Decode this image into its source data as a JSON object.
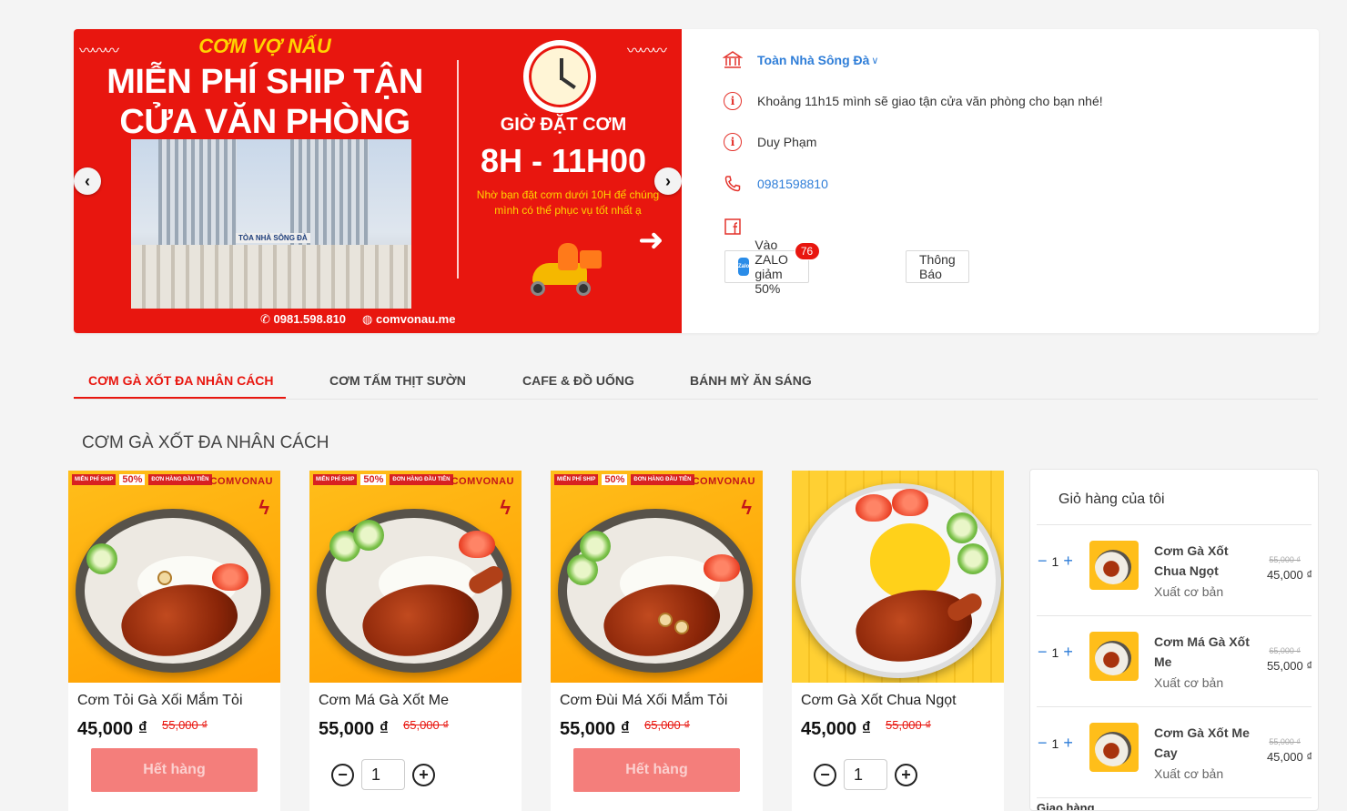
{
  "header": {
    "banner": {
      "brand": "CƠM VỢ NẤU",
      "headline_1": "MIỄN PHÍ SHIP TẬN",
      "headline_2": "CỬA VĂN PHÒNG",
      "building_sign": "TÒA NHÀ SÔNG ĐÀ",
      "order_label": "GIỜ ĐẶT CƠM",
      "order_time": "8H - 11H00",
      "note": "Nhờ bạn đặt cơm dưới 10H để chúng mình có thể phục vụ tốt nhất ạ",
      "phone": "0981.598.810",
      "website": "comvonau.me"
    },
    "info": {
      "location": "Toàn Nhà Sông Đà",
      "delivery_note": "Khoảng 11h15 mình sẽ giao tận cửa văn phòng cho bạn nhé!",
      "owner": "Duy Phạm",
      "phone": "0981598810"
    },
    "zalo_button": "Vào ZALO giảm 50%",
    "zalo_logo": "Zalo",
    "zalo_badge": "76",
    "notice_button": "Thông Báo"
  },
  "tabs": [
    {
      "label": "CƠM GÀ XỐT ĐA NHÂN CÁCH",
      "active": true
    },
    {
      "label": "CƠM TẤM THỊT SƯỜN",
      "active": false
    },
    {
      "label": "CAFE & ĐỒ UỐNG",
      "active": false
    },
    {
      "label": "BÁNH MỲ ĂN SÁNG",
      "active": false
    }
  ],
  "section_title": "CƠM GÀ XỐT ĐA NHÂN CÁCH",
  "product_tag": {
    "free_ship": "MIỄN PHÍ SHIP",
    "discount_pct": "50%",
    "first_order": "ĐƠN HÀNG ĐẦU TIÊN",
    "brand": "COMVONAU"
  },
  "products": [
    {
      "name": "Cơm Tỏi Gà Xối Mắm Tỏi",
      "price": "45,000 ₫",
      "old_price": "55,000 ₫",
      "action": "Hết hàng"
    },
    {
      "name": "Cơm Má Gà Xốt Me",
      "price": "55,000 ₫",
      "old_price": "65,000 ₫",
      "qty": "1"
    },
    {
      "name": "Cơm Đùi Má Xối Mắm Tỏi",
      "price": "55,000 ₫",
      "old_price": "65,000 ₫",
      "action": "Hết hàng"
    },
    {
      "name": "Cơm Gà Xốt Chua Ngọt",
      "price": "45,000 ₫",
      "old_price": "55,000 ₫",
      "qty": "1"
    }
  ],
  "cart": {
    "title": "Giỏ hàng của tôi",
    "items": [
      {
        "name": "Cơm Gà Xốt Chua Ngọt",
        "option": "Xuất cơ bản",
        "qty": "1",
        "old_price": "55,000 ₫",
        "price": "45,000 ₫"
      },
      {
        "name": "Cơm Má Gà Xốt Me",
        "option": "Xuất cơ bản",
        "qty": "1",
        "old_price": "65,000 ₫",
        "price": "55,000 ₫"
      },
      {
        "name": "Cơm Gà Xốt Me Cay",
        "option": "Xuất cơ bản",
        "qty": "1",
        "old_price": "55,000 ₫",
        "price": "45,000 ₫"
      }
    ],
    "footer_label": "Giao hàng"
  },
  "icons": {
    "minus": "−",
    "plus": "+",
    "prev": "‹",
    "next": "›",
    "arrow": "➜",
    "chevron": "∨",
    "info": "i"
  }
}
